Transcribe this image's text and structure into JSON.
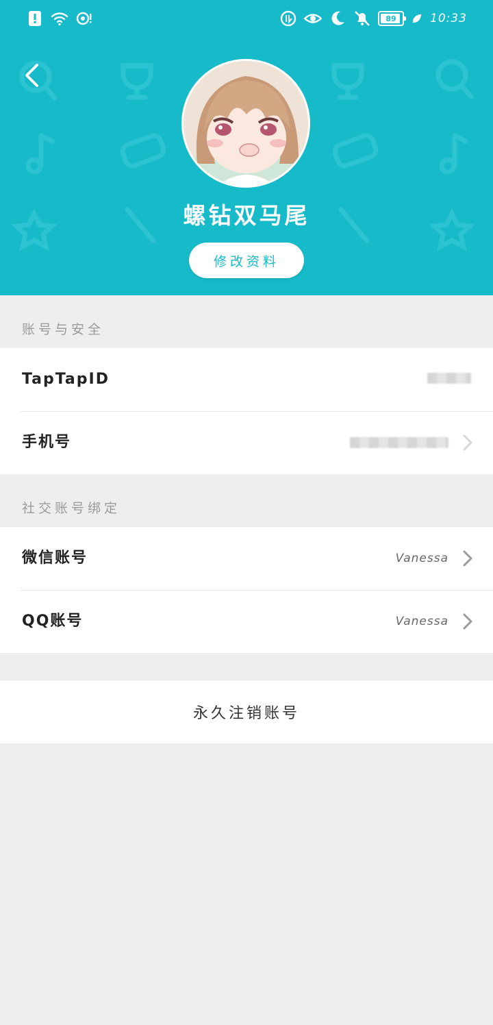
{
  "status_bar": {
    "time": "10:33",
    "battery_level": "89",
    "left_icons": [
      "alert-icon",
      "wifi-icon",
      "hotspot-icon"
    ],
    "right_icons": [
      "data-saver-icon",
      "eye-comfort-icon",
      "moon-icon",
      "mute-bell-icon"
    ]
  },
  "profile": {
    "username": "螺钻双马尾",
    "edit_button_label": "修改资料"
  },
  "account_security": {
    "title": "账号与安全",
    "items": [
      {
        "label": "TapTapID",
        "value_hidden": true
      },
      {
        "label": "手机号",
        "value_hidden": true
      }
    ]
  },
  "social_binding": {
    "title": "社交账号绑定",
    "items": [
      {
        "label": "微信账号",
        "value": "Vanessa"
      },
      {
        "label": "QQ账号",
        "value": "Vanessa"
      }
    ]
  },
  "danger": {
    "delete_account_label": "永久注销账号"
  },
  "colors": {
    "accent": "#17bac9",
    "background": "#eeeeee"
  }
}
